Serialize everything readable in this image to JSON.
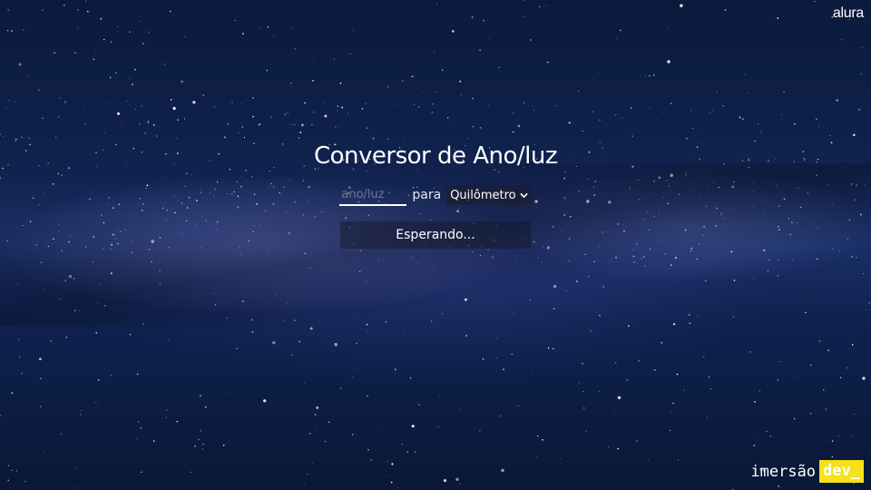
{
  "brand": {
    "logo_text": "alura"
  },
  "converter": {
    "title": "Conversor de Ano/luz",
    "input_placeholder": "ano/luz",
    "input_value": "",
    "para_label": "para",
    "selected_unit": "Quilômetro",
    "result_text": "Esperando..."
  },
  "badge": {
    "word": "imersão",
    "highlight": "dev_"
  },
  "colors": {
    "background": "#10234f",
    "text": "#ffffff",
    "badge_highlight": "#f5e11c"
  },
  "icons": {
    "select_arrow": "chevron-down-icon"
  }
}
